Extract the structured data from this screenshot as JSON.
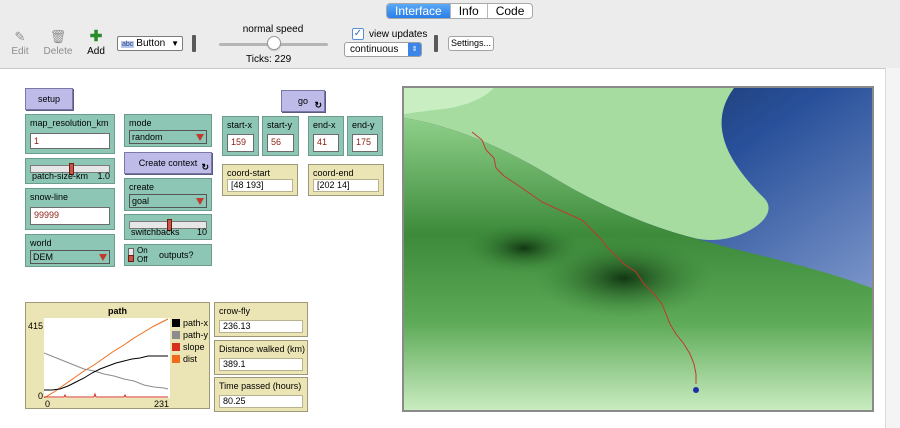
{
  "tabs": [
    {
      "label": "Interface",
      "active": true
    },
    {
      "label": "Info",
      "active": false
    },
    {
      "label": "Code",
      "active": false
    }
  ],
  "toolbar": {
    "edit_label": "Edit",
    "delete_label": "Delete",
    "add_label": "Add",
    "widget_type": "Button",
    "speed_label": "normal speed",
    "speed_fraction": 0.5,
    "ticks_text": "Ticks: 229",
    "view_updates_label": "view updates",
    "view_updates_checked": true,
    "update_mode": "continuous",
    "settings_label": "Settings..."
  },
  "widgets": {
    "setup_label": "setup",
    "go_label": "go",
    "map_resolution": {
      "label": "map_resolution_km",
      "value": "1"
    },
    "patch_size": {
      "label": "patch-size-km",
      "value": "1.0",
      "fraction": 0.5
    },
    "snow_line": {
      "label": "snow-line",
      "value": "99999"
    },
    "world": {
      "label": "world",
      "value": "DEM"
    },
    "mode": {
      "label": "mode",
      "value": "random"
    },
    "create_context_label": "Create context",
    "create": {
      "label": "create",
      "value": "goal"
    },
    "switchbacks": {
      "label": "switchbacks",
      "value": "10",
      "fraction": 0.5
    },
    "outputs": {
      "on": "On",
      "off": "Off",
      "label": "outputs?"
    },
    "start_x": {
      "label": "start-x",
      "value": "159"
    },
    "start_y": {
      "label": "start-y",
      "value": "56"
    },
    "end_x": {
      "label": "end-x",
      "value": "41"
    },
    "end_y": {
      "label": "end-y",
      "value": "175"
    },
    "coord_start": {
      "label": "coord-start",
      "value": "[48 193]"
    },
    "coord_end": {
      "label": "coord-end",
      "value": "[202 14]"
    },
    "crow_fly": {
      "label": "crow-fly",
      "value": "236.13"
    },
    "distance": {
      "label": "Distance walked (km)",
      "value": "389.1"
    },
    "time": {
      "label": "Time passed (hours)",
      "value": "80.25"
    }
  },
  "plot": {
    "title": "path",
    "y_max": "415",
    "y_min": "0",
    "x_min": "0",
    "x_max": "231",
    "legend": [
      {
        "name": "path-x",
        "color": "#000000"
      },
      {
        "name": "path-y",
        "color": "#8c8c8c"
      },
      {
        "name": "slope",
        "color": "#d7301f"
      },
      {
        "name": "dist",
        "color": "#f06a1a"
      }
    ]
  },
  "colors": {
    "button": "#bebbe8",
    "input": "#8dc6b4",
    "monitor": "#ebe4b4",
    "path_line": "#c0392b"
  }
}
